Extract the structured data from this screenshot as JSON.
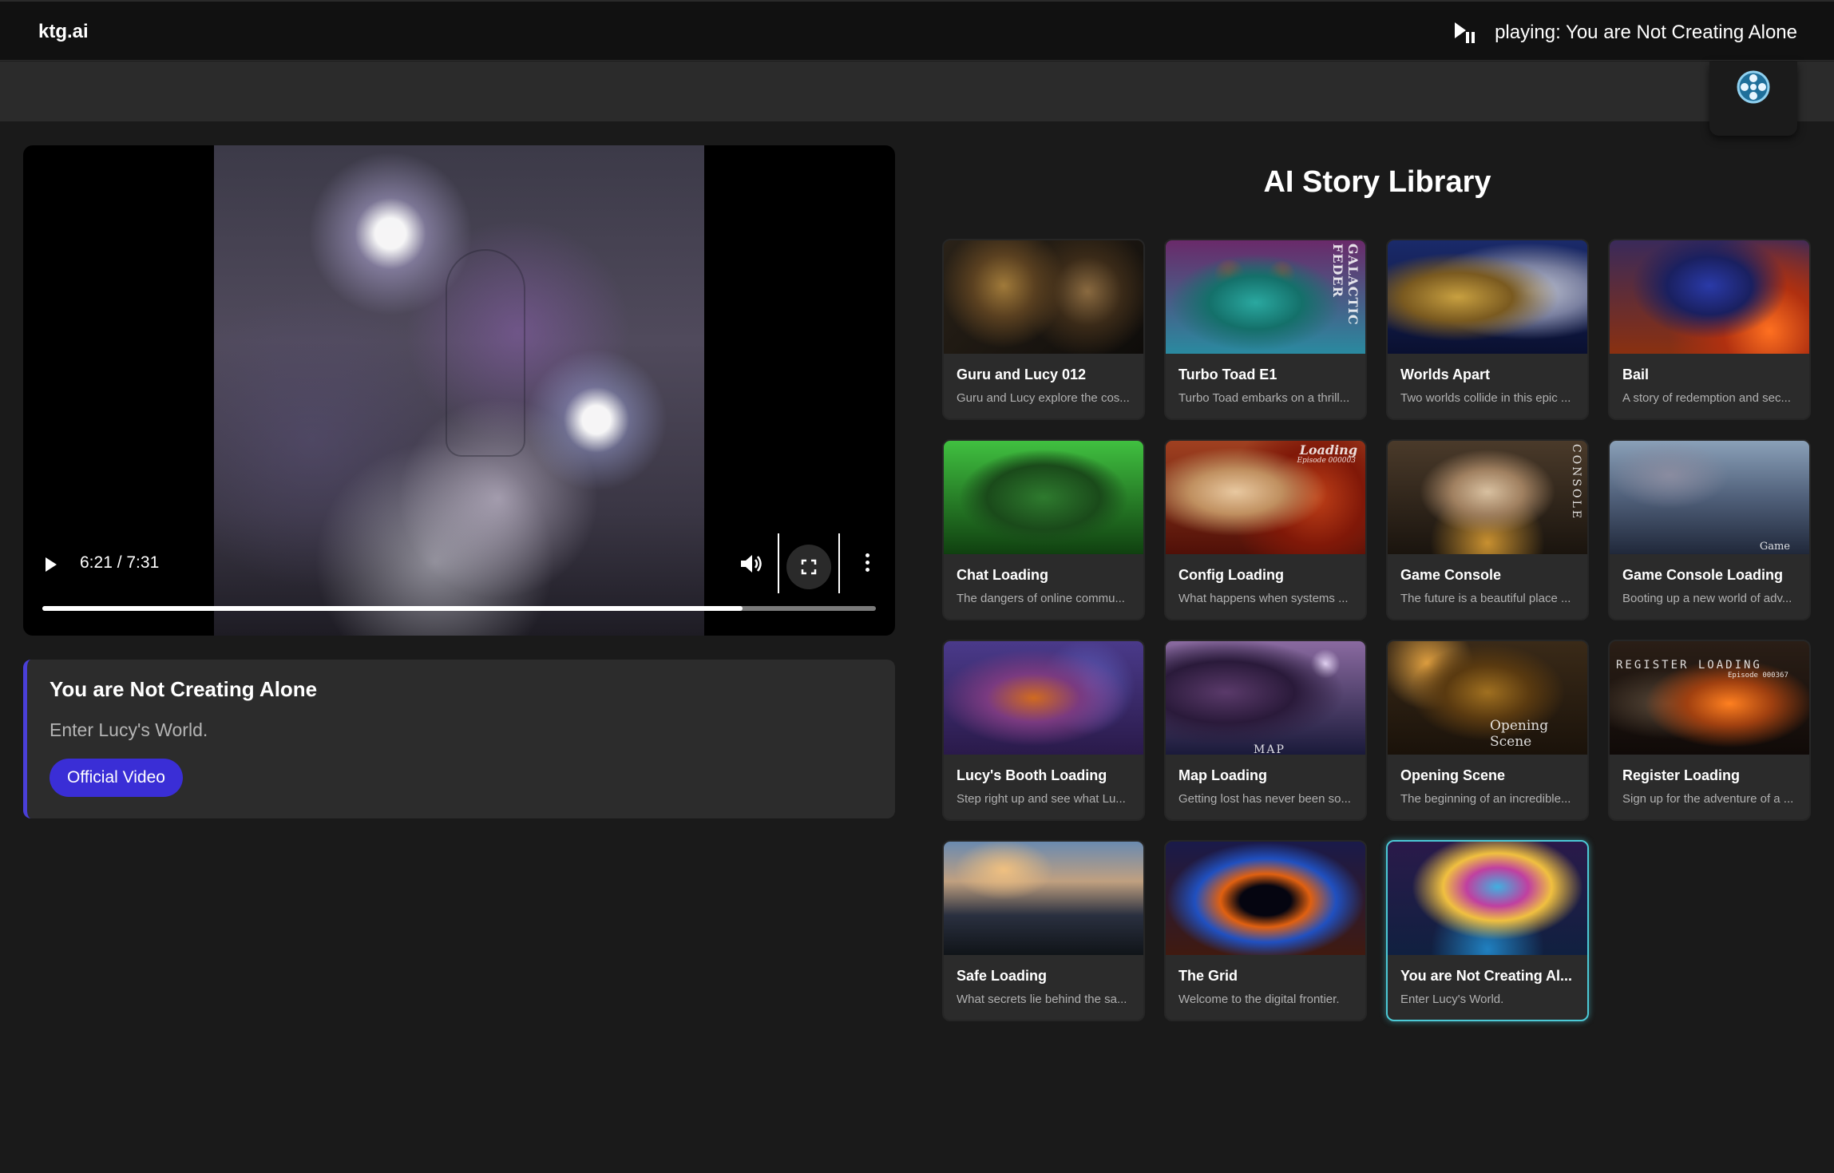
{
  "header": {
    "brand": "ktg.ai",
    "now_playing": "playing: You are Not Creating Alone",
    "play_icon": "play-pause-icon"
  },
  "subbar": {
    "reel_icon": "film-reel-icon"
  },
  "player": {
    "time": "6:21 / 7:31",
    "progress": 0.84,
    "icons": [
      "play-icon",
      "volume-icon",
      "fullscreen-icon",
      "more-vert-icon"
    ]
  },
  "now_showing": {
    "title": "You are Not Creating Alone",
    "subtitle": "Enter Lucy's World.",
    "button": "Official Video",
    "accent": "#4a3fd8"
  },
  "library": {
    "title": "AI Story Library",
    "highlight_color": "#4cc9d6",
    "items": [
      {
        "title": "Guru and Lucy 012",
        "desc": "Guru and Lucy explore the cos..."
      },
      {
        "title": "Turbo Toad E1",
        "desc": "Turbo Toad embarks on a thrill...",
        "overlay": "GALACTIC FEDER"
      },
      {
        "title": "Worlds Apart",
        "desc": "Two worlds collide in this epic ..."
      },
      {
        "title": "Bail",
        "desc": "A story of redemption and sec..."
      },
      {
        "title": "Chat Loading",
        "desc": "The dangers of online commu..."
      },
      {
        "title": "Config Loading",
        "desc": "What happens when systems ...",
        "overlay": "Loading",
        "overlay_sub": "Episode 000003"
      },
      {
        "title": "Game Console",
        "desc": "The future is a beautiful place ...",
        "overlay": "CONSOLE"
      },
      {
        "title": "Game Console Loading",
        "desc": "Booting up a new world of adv...",
        "overlay": "Game"
      },
      {
        "title": "Lucy's Booth Loading",
        "desc": "Step right up and see what Lu..."
      },
      {
        "title": "Map Loading",
        "desc": "Getting lost has never been so...",
        "overlay": "MAP"
      },
      {
        "title": "Opening Scene",
        "desc": "The beginning of an incredible...",
        "overlay": "Opening Scene"
      },
      {
        "title": "Register Loading",
        "desc": "Sign up for the adventure of a ...",
        "overlay": "REGISTER LOADING",
        "overlay_sub": "Episode 000367"
      },
      {
        "title": "Safe Loading",
        "desc": "What secrets lie behind the sa..."
      },
      {
        "title": "The Grid",
        "desc": "Welcome to the digital frontier."
      },
      {
        "title": "You are Not Creating Al...",
        "desc": "Enter Lucy's World.",
        "active": true
      }
    ]
  }
}
